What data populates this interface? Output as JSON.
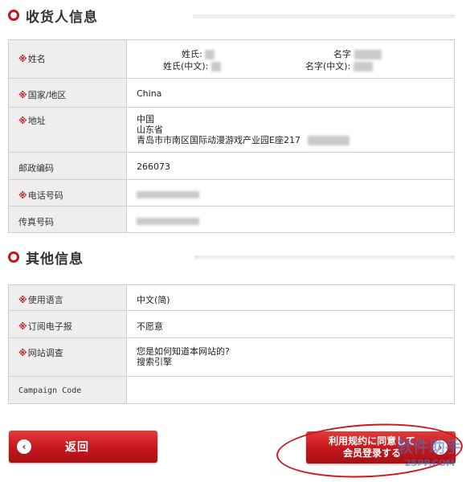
{
  "consignee": {
    "title": "收货人信息",
    "rows": {
      "name_label": "姓名",
      "surname_label": "姓氏:",
      "given_label": "名字",
      "surname_cn_label": "姓氏(中文):",
      "given_cn_label": "名字(中文):",
      "country_label": "国家/地区",
      "country_value": "China",
      "address_label": "地址",
      "address_line1": "中国",
      "address_line2": "山东省",
      "address_line3": "青岛市市南区国际动漫游戏产业园E座217",
      "zip_label": "邮政编码",
      "zip_value": "266073",
      "phone_label": "电话号码",
      "fax_label": "传真号码"
    }
  },
  "other": {
    "title": "其他信息",
    "rows": {
      "language_label": "使用语言",
      "language_value": "中文(简)",
      "newsletter_label": "订阅电子报",
      "newsletter_value": "不愿意",
      "survey_label": "网站调查",
      "survey_question": "您是如何知道本网站的?",
      "survey_answer": "搜索引擎",
      "campaign_label": "Campaign Code"
    }
  },
  "required_mark": "※",
  "buttons": {
    "back_label": "返回",
    "submit_line1": "利用规约に同意して",
    "submit_line2": "会员登录する",
    "arrow_left": "‹",
    "arrow_right": "›"
  },
  "watermark": {
    "text": "软件助手",
    "url": "25PP.COM"
  },
  "colors": {
    "accent": "#c4161c",
    "label_bg": "#eeeeee",
    "border": "#cfcfcf"
  }
}
